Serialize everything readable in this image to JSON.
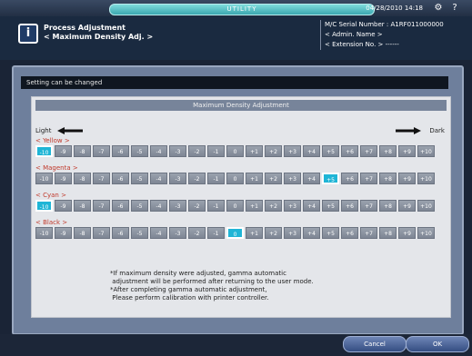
{
  "topbar": {
    "utility_label": "UTILITY",
    "datetime": "04/28/2010 14:18"
  },
  "header": {
    "title_line1": "Process Adjustment",
    "title_line2": "< Maximum Density Adj. >",
    "serial_line": "M/C Serial Number : A1RF011000000",
    "admin_line": "< Admin. Name >",
    "extension_line": "< Extension No. > ------"
  },
  "status": "Setting can be changed",
  "panel": {
    "title": "Maximum Density Adjustment",
    "light_label": "Light",
    "dark_label": "Dark"
  },
  "scale_values": [
    "-10",
    "-9",
    "-8",
    "-7",
    "-6",
    "-5",
    "-4",
    "-3",
    "-2",
    "-1",
    "0",
    "+1",
    "+2",
    "+3",
    "+4",
    "+5",
    "+6",
    "+7",
    "+8",
    "+9",
    "+10"
  ],
  "colors": [
    {
      "label": "< Yellow >",
      "selected": "-10"
    },
    {
      "label": "< Magenta >",
      "selected": "+5"
    },
    {
      "label": "< Cyan >",
      "selected": "-10"
    },
    {
      "label": "< Black >",
      "selected": "0"
    }
  ],
  "notes": "*If maximum density were adjusted, gamma automatic\n adjustment will be performed after returning to the user mode.\n*After completing gamma automatic adjustment,\n Please perform calibration with printer controller.",
  "buttons": {
    "cancel": "Cancel",
    "ok": "OK"
  }
}
